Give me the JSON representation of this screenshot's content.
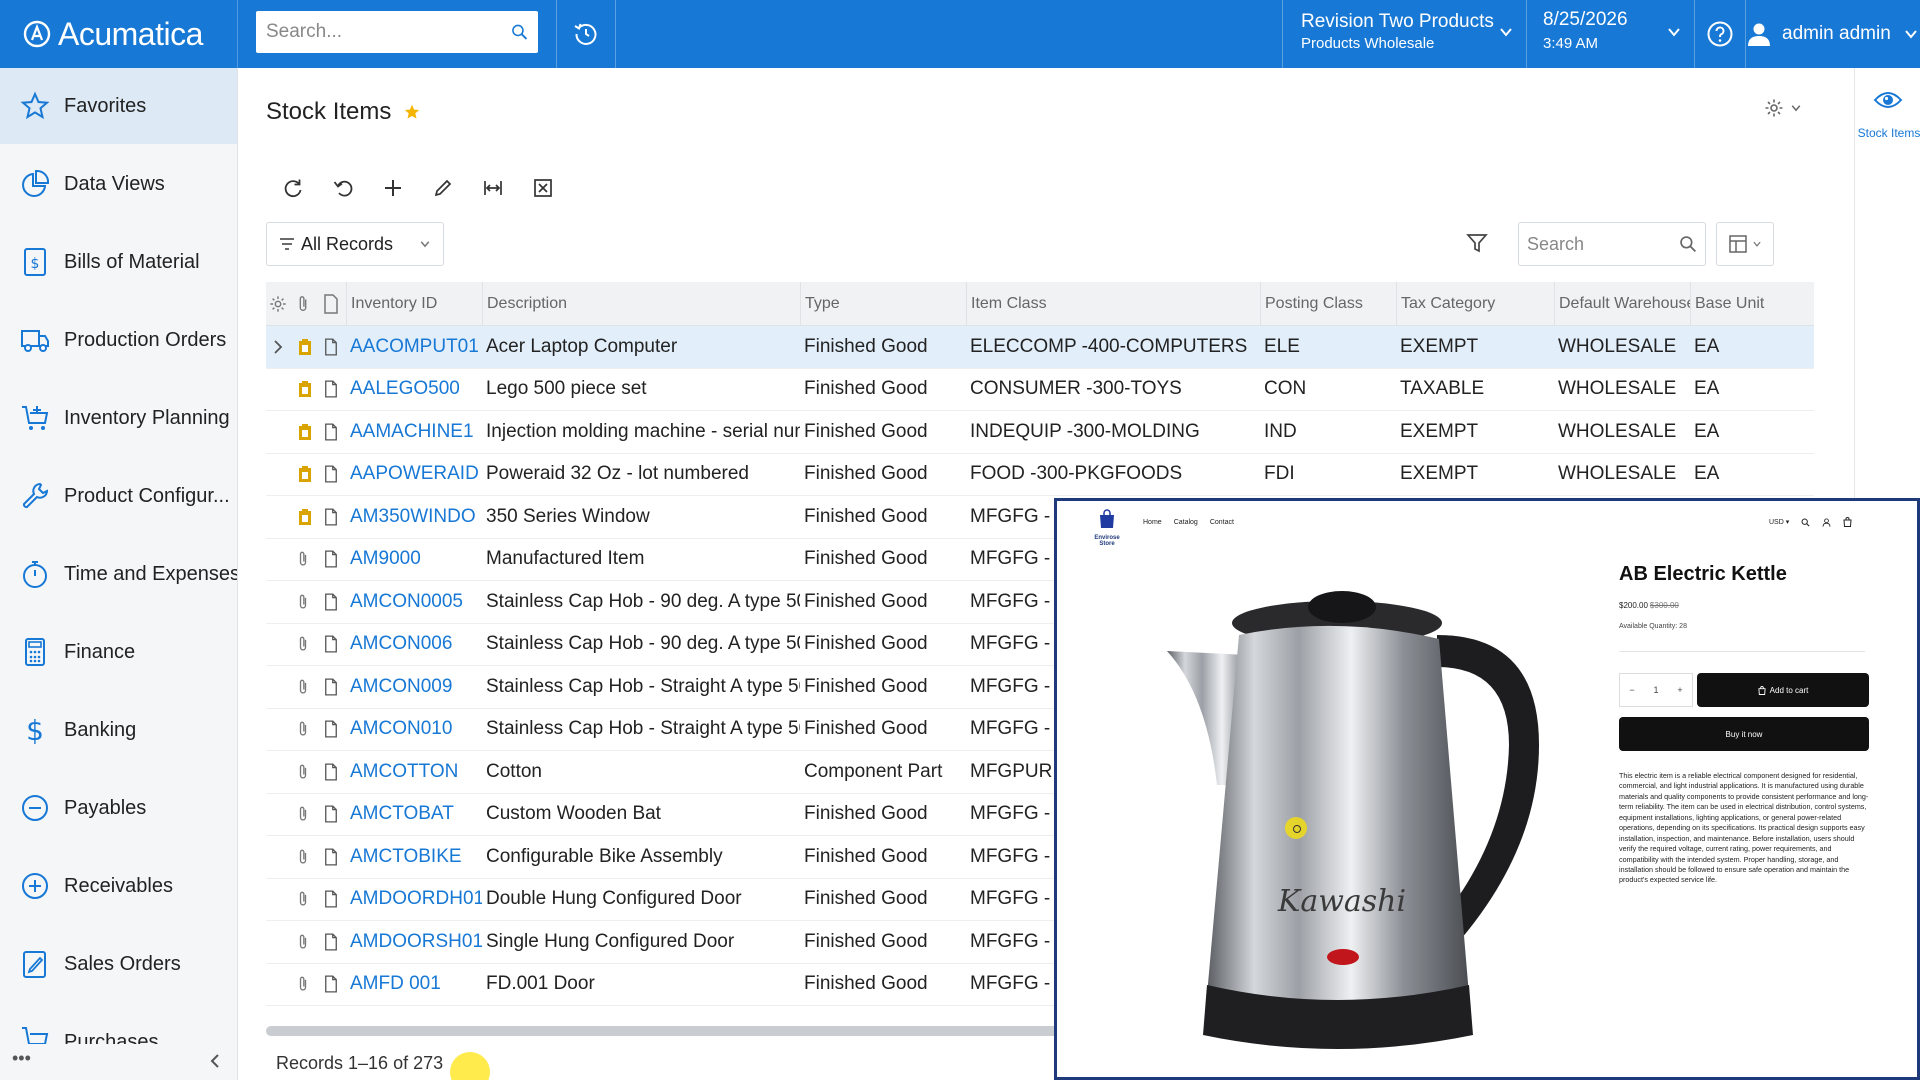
{
  "app": {
    "name": "Acumatica"
  },
  "topbar": {
    "search_placeholder": "Search...",
    "company_line1": "Revision Two Products",
    "company_line2": "Products Wholesale",
    "date": "8/25/2026",
    "time": "3:49 AM",
    "user": "admin admin"
  },
  "sidebar": {
    "items": [
      {
        "label": "Favorites",
        "icon": "star-icon"
      },
      {
        "label": "Data Views",
        "icon": "pie-chart-icon"
      },
      {
        "label": "Bills of Material",
        "icon": "document-dollar-icon"
      },
      {
        "label": "Production Orders",
        "icon": "truck-icon"
      },
      {
        "label": "Inventory Planning",
        "icon": "cart-plus-icon"
      },
      {
        "label": "Product Configur...",
        "icon": "wrench-icon"
      },
      {
        "label": "Time and Expenses",
        "icon": "stopwatch-icon"
      },
      {
        "label": "Finance",
        "icon": "calculator-icon"
      },
      {
        "label": "Banking",
        "icon": "dollar-icon"
      },
      {
        "label": "Payables",
        "icon": "minus-circle-icon"
      },
      {
        "label": "Receivables",
        "icon": "plus-circle-icon"
      },
      {
        "label": "Sales Orders",
        "icon": "edit-document-icon"
      },
      {
        "label": "Purchases",
        "icon": "cart-icon"
      }
    ]
  },
  "page": {
    "title": "Stock Items",
    "filter_label": "All Records",
    "search_placeholder": "Search",
    "records_text": "Records 1–16 of 273"
  },
  "right_panel": {
    "label": "Stock Items"
  },
  "grid": {
    "columns": [
      "Inventory ID",
      "Description",
      "Type",
      "Item Class",
      "Posting Class",
      "Tax Category",
      "Default Warehouse",
      "Base Unit"
    ],
    "rows": [
      {
        "id": "AACOMPUT01",
        "desc": "Acer Laptop Computer",
        "type": "Finished Good",
        "cls": "ELECCOMP -400-COMPUTERS",
        "post": "ELE",
        "tax": "EXEMPT",
        "wh": "WHOLESALE",
        "unit": "EA",
        "hasFile": true
      },
      {
        "id": "AALEGO500",
        "desc": "Lego 500 piece set",
        "type": "Finished Good",
        "cls": "CONSUMER -300-TOYS",
        "post": "CON",
        "tax": "TAXABLE",
        "wh": "WHOLESALE",
        "unit": "EA",
        "hasFile": true
      },
      {
        "id": "AAMACHINE1",
        "desc": "Injection molding machine - serial numbe...",
        "type": "Finished Good",
        "cls": "INDEQUIP -300-MOLDING",
        "post": "IND",
        "tax": "EXEMPT",
        "wh": "WHOLESALE",
        "unit": "EA",
        "hasFile": true
      },
      {
        "id": "AAPOWERAID",
        "desc": "Poweraid 32 Oz - lot numbered",
        "type": "Finished Good",
        "cls": "FOOD -300-PKGFOODS",
        "post": "FDI",
        "tax": "EXEMPT",
        "wh": "WHOLESALE",
        "unit": "EA",
        "hasFile": true
      },
      {
        "id": "AM350WINDO",
        "desc": "350 Series Window",
        "type": "Finished Good",
        "cls": "MFGFG - -",
        "post": "",
        "tax": "",
        "wh": "",
        "unit": "",
        "hasFile": true
      },
      {
        "id": "AM9000",
        "desc": "Manufactured Item",
        "type": "Finished Good",
        "cls": "MFGFG - -",
        "post": "",
        "tax": "",
        "wh": "",
        "unit": "",
        "hasFile": false
      },
      {
        "id": "AMCON0005",
        "desc": "Stainless Cap Hob - 90 deg. A type 50m...",
        "type": "Finished Good",
        "cls": "MFGFG - -",
        "post": "",
        "tax": "",
        "wh": "",
        "unit": "",
        "hasFile": false
      },
      {
        "id": "AMCON006",
        "desc": "Stainless Cap Hob - 90 deg. A type 50m...",
        "type": "Finished Good",
        "cls": "MFGFG - -",
        "post": "",
        "tax": "",
        "wh": "",
        "unit": "",
        "hasFile": false
      },
      {
        "id": "AMCON009",
        "desc": "Stainless Cap Hob - Straight A type 50m...",
        "type": "Finished Good",
        "cls": "MFGFG - -",
        "post": "",
        "tax": "",
        "wh": "",
        "unit": "",
        "hasFile": false
      },
      {
        "id": "AMCON010",
        "desc": "Stainless Cap Hob - Straight A type 50m...",
        "type": "Finished Good",
        "cls": "MFGFG - -",
        "post": "",
        "tax": "",
        "wh": "",
        "unit": "",
        "hasFile": false
      },
      {
        "id": "AMCOTTON",
        "desc": "Cotton",
        "type": "Component Part",
        "cls": "MFGPUR -",
        "post": "",
        "tax": "",
        "wh": "",
        "unit": "",
        "hasFile": false
      },
      {
        "id": "AMCTOBAT",
        "desc": "Custom Wooden Bat",
        "type": "Finished Good",
        "cls": "MFGFG - -",
        "post": "",
        "tax": "",
        "wh": "",
        "unit": "",
        "hasFile": false
      },
      {
        "id": "AMCTOBIKE",
        "desc": "Configurable Bike Assembly",
        "type": "Finished Good",
        "cls": "MFGFG - -",
        "post": "",
        "tax": "",
        "wh": "",
        "unit": "",
        "hasFile": false
      },
      {
        "id": "AMDOORDH01",
        "desc": "Double Hung Configured Door",
        "type": "Finished Good",
        "cls": "MFGFG - -",
        "post": "",
        "tax": "",
        "wh": "",
        "unit": "",
        "hasFile": false
      },
      {
        "id": "AMDOORSH01",
        "desc": "Single Hung Configured Door",
        "type": "Finished Good",
        "cls": "MFGFG - -",
        "post": "",
        "tax": "",
        "wh": "",
        "unit": "",
        "hasFile": false
      },
      {
        "id": "AMFD 001",
        "desc": "FD.001 Door",
        "type": "Finished Good",
        "cls": "MFGFG - -",
        "post": "",
        "tax": "",
        "wh": "",
        "unit": "",
        "hasFile": false
      }
    ]
  },
  "store": {
    "brand": "Envirose Store",
    "nav": [
      "Home",
      "Catalog",
      "Contact"
    ],
    "currency": "USD",
    "product_title": "AB Electric Kettle",
    "price": "$200.00",
    "old_price": "$300.00",
    "available": "Available Quantity: 28",
    "qty": "1",
    "add_to_cart": "Add to cart",
    "buy_now": "Buy it now",
    "kettle_brand": "Kawashi",
    "description": "This electric item is a reliable electrical component designed for residential, commercial, and light industrial applications. It is manufactured using durable materials and quality components to provide consistent performance and long-term reliability. The item can be used in electrical distribution, control systems, equipment installations, lighting applications, or general power-related operations, depending on its specifications. Its practical design supports easy installation, inspection, and maintenance. Before installation, users should verify the required voltage, current rating, power requirements, and compatibility with the intended system. Proper handling, storage, and installation should be followed to ensure safe operation and maintain the product's expected service life."
  },
  "colors": {
    "brand_blue": "#1778d5",
    "link": "#1778d5",
    "file_gold": "#d9a300"
  }
}
